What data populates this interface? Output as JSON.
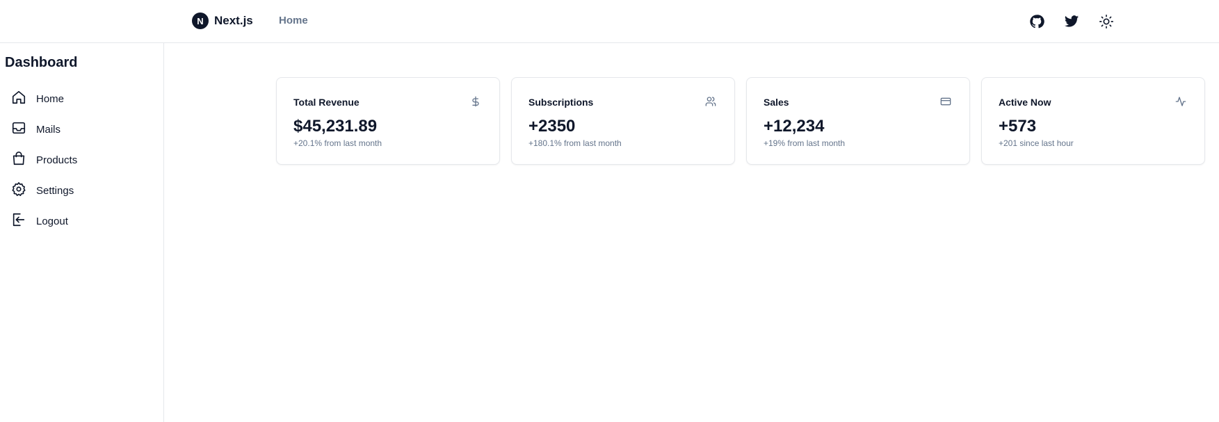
{
  "header": {
    "brand_name": "Next.js",
    "brand_logo_letter": "N",
    "nav_home": "Home",
    "icons": [
      "github-icon",
      "twitter-icon",
      "sun-icon"
    ]
  },
  "sidebar": {
    "title": "Dashboard",
    "items": [
      {
        "label": "Home",
        "icon": "home-icon"
      },
      {
        "label": "Mails",
        "icon": "inbox-icon"
      },
      {
        "label": "Products",
        "icon": "shopping-bag-icon"
      },
      {
        "label": "Settings",
        "icon": "gear-icon"
      },
      {
        "label": "Logout",
        "icon": "logout-icon"
      }
    ]
  },
  "cards": [
    {
      "title": "Total Revenue",
      "value": "$45,231.89",
      "sub": "+20.1% from last month",
      "icon": "dollar-icon"
    },
    {
      "title": "Subscriptions",
      "value": "+2350",
      "sub": "+180.1% from last month",
      "icon": "users-icon"
    },
    {
      "title": "Sales",
      "value": "+12,234",
      "sub": "+19% from last month",
      "icon": "credit-card-icon"
    },
    {
      "title": "Active Now",
      "value": "+573",
      "sub": "+201 since last hour",
      "icon": "activity-icon"
    }
  ],
  "colors": {
    "text": "#0f172a",
    "muted": "#64748b",
    "border": "#e5e7eb"
  }
}
